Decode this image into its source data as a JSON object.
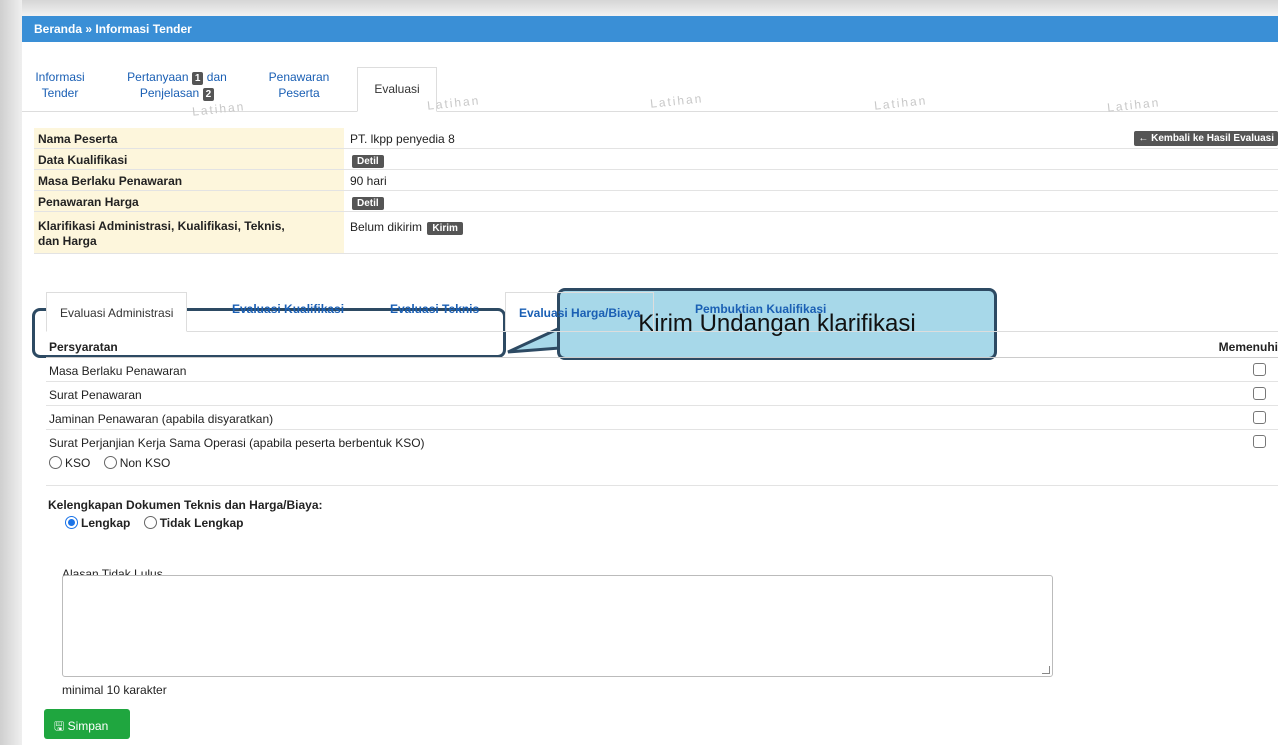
{
  "breadcrumb": {
    "text": "Beranda » Informasi Tender"
  },
  "tabs": [
    {
      "line1": "Informasi",
      "line2": "Tender"
    },
    {
      "line1a": "Pertanyaan",
      "badge1": "1",
      "line1b": "dan",
      "line2": "Penjelasan",
      "badge2": "2"
    },
    {
      "line1": "Penawaran",
      "line2": "Peserta"
    },
    {
      "label": "Evaluasi"
    }
  ],
  "watermark": "Latihan",
  "info": {
    "nama_peserta": {
      "label": "Nama Peserta",
      "value": "PT. lkpp penyedia 8"
    },
    "back_button": "← Kembali ke Hasil Evaluasi",
    "data_kualifikasi": {
      "label": "Data Kualifikasi",
      "button": "Detil"
    },
    "masa_berlaku": {
      "label": "Masa Berlaku Penawaran",
      "value": "90 hari"
    },
    "penawaran_harga": {
      "label": "Penawaran Harga",
      "button": "Detil"
    },
    "klarifikasi": {
      "label1": "Klarifikasi Administrasi, Kualifikasi, Teknis,",
      "label2": "dan Harga",
      "value": "Belum dikirim",
      "button": "Kirim"
    }
  },
  "callout": {
    "text": "Kirim Undangan klarifikasi"
  },
  "subtabs": [
    "Evaluasi Administrasi",
    "Evaluasi Kualifikasi",
    "Evaluasi Teknis",
    "Evaluasi Harga/Biaya",
    "Pembuktian Kualifikasi"
  ],
  "requirements": {
    "header": "Persyaratan",
    "header_right": "Memenuhi",
    "items": [
      "Masa Berlaku Penawaran",
      "Surat Penawaran",
      "Jaminan Penawaran (apabila disyaratkan)",
      "Surat Perjanjian Kerja Sama Operasi (apabila peserta berbentuk KSO)"
    ],
    "kso_options": [
      "KSO",
      "Non KSO"
    ]
  },
  "kelengkapan": {
    "title": "Kelengkapan Dokumen Teknis dan Harga/Biaya:",
    "options": [
      "Lengkap",
      "Tidak Lengkap"
    ],
    "selected": "Lengkap"
  },
  "alasan": {
    "label": "Alasan Tidak Lulus",
    "value": "",
    "hint": "minimal 10 karakter"
  },
  "save_button": "Simpan",
  "colors": {
    "topbar": "#3a8fd6",
    "link": "#1a5fb4",
    "label_bg": "#fdf6dc",
    "save": "#1fa63f",
    "callout": "#a7d8e9"
  }
}
